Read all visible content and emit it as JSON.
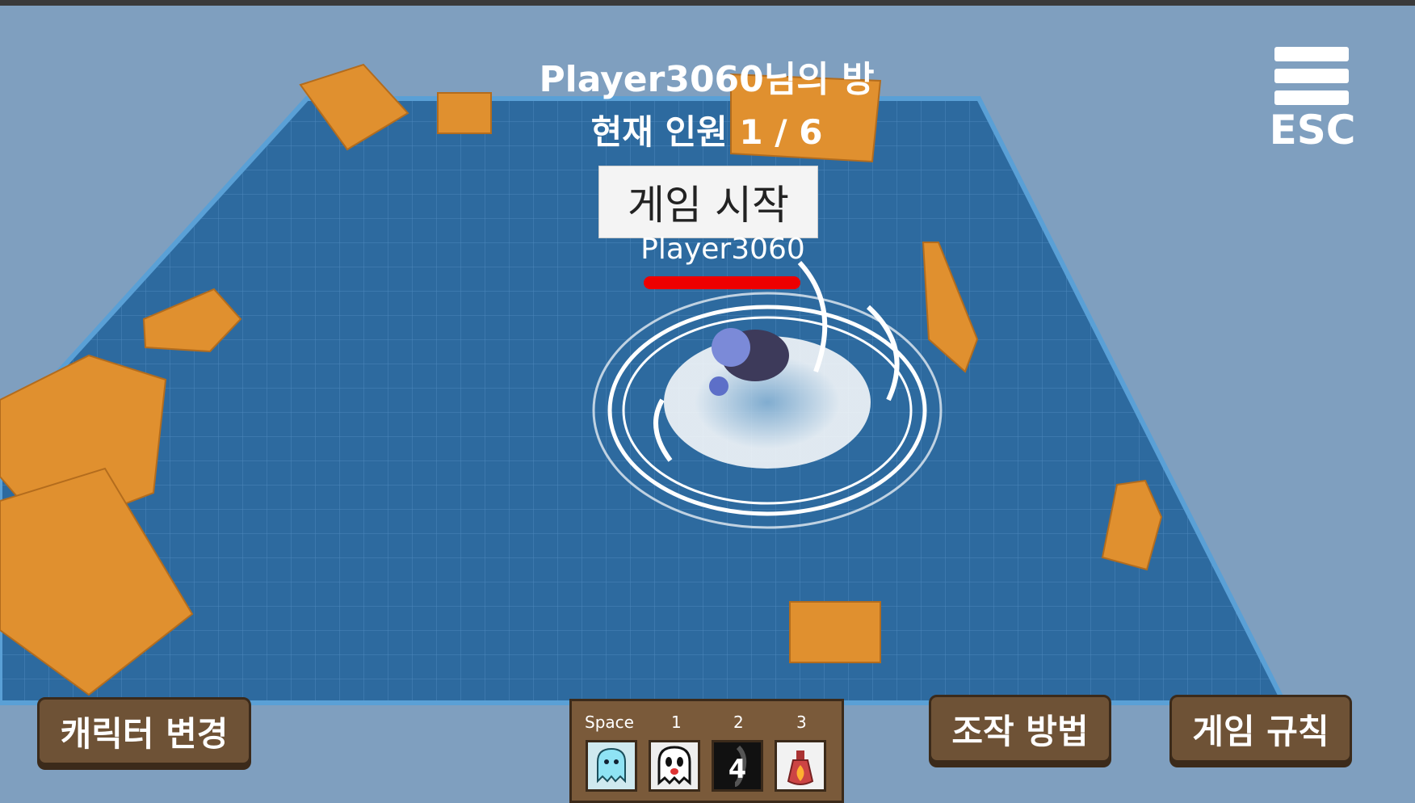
{
  "hud": {
    "room_title": "Player3060님의 방",
    "player_count": "현재 인원 1 / 6",
    "start_button": "게임 시작",
    "player_name": "Player3060",
    "health": 1.0
  },
  "menu": {
    "esc_label": "ESC"
  },
  "bottom_buttons": {
    "change_character": "캐릭터 변경",
    "controls": "조작 방법",
    "rules": "게임 규칙"
  },
  "skillbar": {
    "slots": [
      {
        "key": "Space",
        "icon": "ghost-icon"
      },
      {
        "key": "1",
        "icon": "white-ghost-icon"
      },
      {
        "key": "2",
        "icon": "dark-item-icon",
        "count": "4"
      },
      {
        "key": "3",
        "icon": "fire-potion-icon"
      }
    ]
  },
  "colors": {
    "floor": "#2d6a9f",
    "block": "#e0902f",
    "wood": "#6e5236"
  }
}
